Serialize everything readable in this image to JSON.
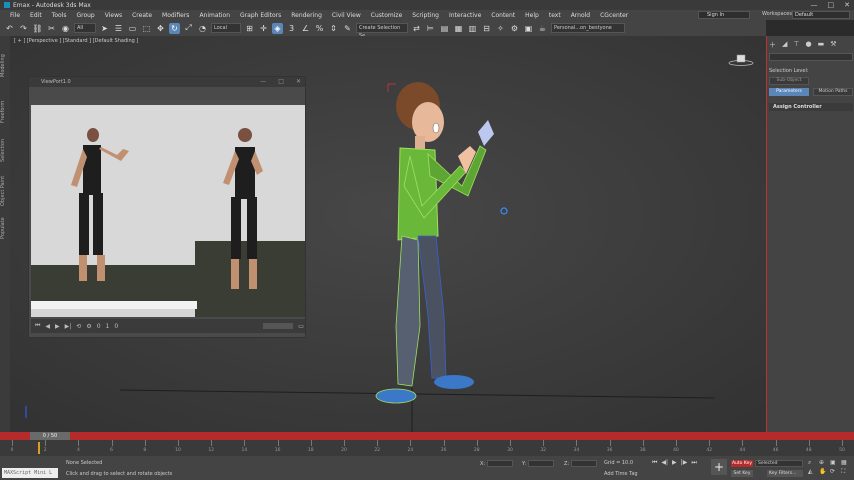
{
  "window": {
    "title": "Emax - Autodesk 3ds Max",
    "controls": [
      "—",
      "□",
      "✕"
    ]
  },
  "menubar": {
    "items": [
      "File",
      "Edit",
      "Tools",
      "Group",
      "Views",
      "Create",
      "Modifiers",
      "Animation",
      "Graph Editors",
      "Rendering",
      "Civil View",
      "Customize",
      "Scripting",
      "Interactive",
      "Content",
      "Help",
      "text",
      "Arnold",
      "CGcenter"
    ],
    "signin": "Sign In",
    "workspaces_label": "Workspaces:",
    "workspace_value": "Default"
  },
  "toolbar": {
    "select_filter": "All",
    "ref_coord": "Local",
    "selection_set": "Create Selection Se",
    "personal": "Personal...on_bestyone",
    "icons": [
      "undo-icon",
      "redo-icon",
      "link-icon",
      "unlink-icon",
      "bind-icon",
      "select-icon",
      "select-name-icon",
      "rect-region-icon",
      "window-crossing-icon",
      "move-icon",
      "rotate-icon",
      "scale-icon",
      "placement-icon",
      "pivot-icon",
      "snap-icon",
      "angle-snap-icon",
      "percent-snap-icon",
      "spinner-snap-icon",
      "mirror-icon",
      "align-icon",
      "layer-icon",
      "graphite-icon",
      "curve-editor-icon",
      "schematic-icon",
      "material-icon",
      "render-setup-icon",
      "render-frame-icon",
      "render-icon"
    ]
  },
  "leftstrip": {
    "tabs": [
      "Modeling",
      "Freeform",
      "Selection",
      "Object Paint",
      "Populate"
    ]
  },
  "viewport": {
    "label": "[ + ] [Perspective ] [Standard ] [Default Shading ]"
  },
  "subwindow": {
    "title": "ViewPort1.0",
    "frame": "0",
    "frame_total": "1",
    "zero": "0"
  },
  "rightpanel": {
    "selection_level": "Selection Level:",
    "sub_object": "Sub-Object",
    "parameters": "Parameters",
    "motion_paths": "Motion Paths",
    "assign_controller": "Assign Controller"
  },
  "timeline": {
    "slider": "0 / 50",
    "ticks": [
      0,
      2,
      4,
      6,
      8,
      10,
      12,
      14,
      16,
      18,
      20,
      22,
      24,
      26,
      28,
      30,
      32,
      34,
      36,
      38,
      40,
      42,
      44,
      46,
      48,
      50
    ],
    "accent": "#b52a2a"
  },
  "status": {
    "maxscript": "MAXScript Mini L",
    "none_selected": "None Selected",
    "prompt": "Click and drag to select and rotate objects",
    "x_label": "X:",
    "y_label": "Y:",
    "z_label": "Z:",
    "grid": "Grid = 10.0",
    "add_time_tag": "Add Time Tag",
    "auto_key": "Auto Key",
    "set_key": "Set Key",
    "selected": "Selected",
    "key_filters": "Key Filters..."
  }
}
